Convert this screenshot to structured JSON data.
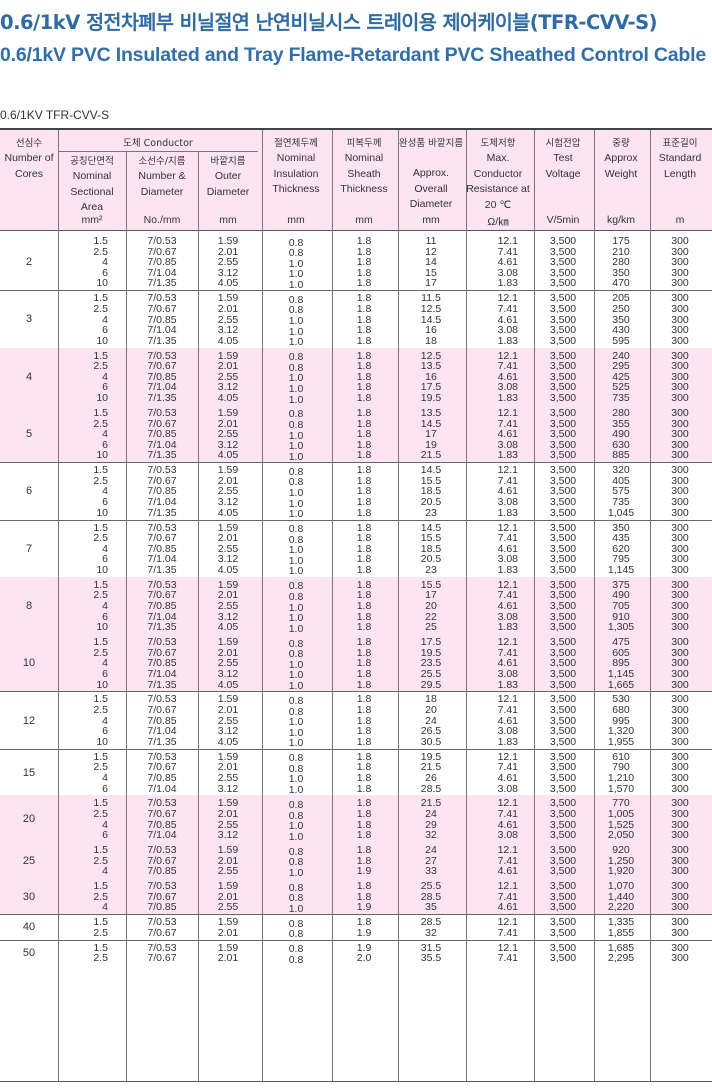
{
  "title_ko": "0.6/1kV  정전차폐부 비닐절연 난연비닐시스 트레이용 제어케이블(TFR-CVV-S)",
  "title_en": "0.6/1kV PVC Insulated and Tray Flame-Retardant PVC Sheathed Control Cable",
  "subtitle": "0.6/1KV TFR-CVV-S",
  "headers": {
    "cores_ko": "선심수",
    "cores_en": "Number of Cores",
    "conductor": "도체 Conductor",
    "area_ko": "공칭단면적",
    "area_en": "Nominal Sectional Area",
    "wire_ko": "소선수/지름",
    "wire_en": "Number & Diameter",
    "od_ko": "바깥지름",
    "od_en": "Outer Diameter",
    "ins_ko": "절연체두께",
    "ins_en": "Nominal Insulation Thickness",
    "sheath_ko": "피복두께",
    "sheath_en": "Nominal Sheath Thickness",
    "overall_ko": "완성품 바깥지름",
    "overall_en": "Approx. Overall Diameter",
    "res_ko": "도체저항",
    "res_en": "Max. Conductor Resistance at 20 ℃",
    "volt_ko": "시험전압",
    "volt_en": "Test Voltage",
    "weight_ko": "중량",
    "weight_en": "Approx Weight",
    "length_ko": "표준길이",
    "length_en": "Standard Length"
  },
  "units": {
    "area": "mm²",
    "wire": "No./mm",
    "od": "mm",
    "ins": "mm",
    "sheath": "mm",
    "overall": "mm",
    "res": "Ω/㎞",
    "volt": "V/5min",
    "weight": "kg/km",
    "length": "m"
  },
  "groups": [
    {
      "cores": "2",
      "pink": false,
      "rows": [
        [
          "1.5",
          "7/0.53",
          "1.59",
          "0.8",
          "1.8",
          "11",
          "12.1",
          "3,500",
          "175",
          "300"
        ],
        [
          "2.5",
          "7/0.67",
          "2.01",
          "0.8",
          "1.8",
          "12",
          "7.41",
          "3,500",
          "210",
          "300"
        ],
        [
          "4",
          "7/0.85",
          "2.55",
          "1.0",
          "1.8",
          "14",
          "4.61",
          "3,500",
          "280",
          "300"
        ],
        [
          "6",
          "7/1.04",
          "3.12",
          "1.0",
          "1.8",
          "15",
          "3.08",
          "3,500",
          "350",
          "300"
        ],
        [
          "10",
          "7/1.35",
          "4.05",
          "1.0",
          "1.8",
          "17",
          "1.83",
          "3,500",
          "470",
          "300"
        ]
      ]
    },
    {
      "cores": "3",
      "pink": false,
      "rows": [
        [
          "1.5",
          "7/0.53",
          "1.59",
          "0.8",
          "1.8",
          "11.5",
          "12.1",
          "3,500",
          "205",
          "300"
        ],
        [
          "2.5",
          "7/0.67",
          "2.01",
          "0.8",
          "1.8",
          "12.5",
          "7.41",
          "3,500",
          "250",
          "300"
        ],
        [
          "4",
          "7/0.85",
          "2.55",
          "1.0",
          "1.8",
          "14.5",
          "4.61",
          "3,500",
          "350",
          "300"
        ],
        [
          "6",
          "7/1.04",
          "3.12",
          "1.0",
          "1.8",
          "16",
          "3.08",
          "3,500",
          "430",
          "300"
        ],
        [
          "10",
          "7/1.35",
          "4.05",
          "1.0",
          "1.8",
          "18",
          "1.83",
          "3,500",
          "595",
          "300"
        ]
      ]
    },
    {
      "cores": "4",
      "pink": true,
      "rows": [
        [
          "1.5",
          "7/0.53",
          "1.59",
          "0.8",
          "1.8",
          "12.5",
          "12.1",
          "3,500",
          "240",
          "300"
        ],
        [
          "2.5",
          "7/0.67",
          "2.01",
          "0.8",
          "1.8",
          "13.5",
          "7.41",
          "3,500",
          "295",
          "300"
        ],
        [
          "4",
          "7/0.85",
          "2.55",
          "1.0",
          "1.8",
          "16",
          "4.61",
          "3,500",
          "425",
          "300"
        ],
        [
          "6",
          "7/1.04",
          "3.12",
          "1.0",
          "1.8",
          "17.5",
          "3.08",
          "3,500",
          "525",
          "300"
        ],
        [
          "10",
          "7/1.35",
          "4.05",
          "1.0",
          "1.8",
          "19.5",
          "1.83",
          "3,500",
          "735",
          "300"
        ]
      ]
    },
    {
      "cores": "5",
      "pink": true,
      "rows": [
        [
          "1.5",
          "7/0.53",
          "1.59",
          "0.8",
          "1.8",
          "13.5",
          "12.1",
          "3,500",
          "280",
          "300"
        ],
        [
          "2.5",
          "7/0.67",
          "2.01",
          "0.8",
          "1.8",
          "14.5",
          "7.41",
          "3,500",
          "355",
          "300"
        ],
        [
          "4",
          "7/0.85",
          "2.55",
          "1.0",
          "1.8",
          "17",
          "4.61",
          "3,500",
          "490",
          "300"
        ],
        [
          "6",
          "7/1.04",
          "3.12",
          "1.0",
          "1.8",
          "19",
          "3.08",
          "3,500",
          "630",
          "300"
        ],
        [
          "10",
          "7/1.35",
          "4.05",
          "1.0",
          "1.8",
          "21.5",
          "1.83",
          "3,500",
          "885",
          "300"
        ]
      ]
    },
    {
      "cores": "6",
      "pink": false,
      "rows": [
        [
          "1.5",
          "7/0.53",
          "1.59",
          "0.8",
          "1.8",
          "14.5",
          "12.1",
          "3,500",
          "320",
          "300"
        ],
        [
          "2.5",
          "7/0.67",
          "2.01",
          "0.8",
          "1.8",
          "15.5",
          "7.41",
          "3,500",
          "405",
          "300"
        ],
        [
          "4",
          "7/0.85",
          "2.55",
          "1.0",
          "1.8",
          "18.5",
          "4.61",
          "3,500",
          "575",
          "300"
        ],
        [
          "6",
          "7/1.04",
          "3.12",
          "1.0",
          "1.8",
          "20.5",
          "3.08",
          "3,500",
          "735",
          "300"
        ],
        [
          "10",
          "7/1.35",
          "4.05",
          "1.0",
          "1.8",
          "23",
          "1.83",
          "3,500",
          "1,045",
          "300"
        ]
      ]
    },
    {
      "cores": "7",
      "pink": false,
      "rows": [
        [
          "1.5",
          "7/0.53",
          "1.59",
          "0.8",
          "1.8",
          "14.5",
          "12.1",
          "3,500",
          "350",
          "300"
        ],
        [
          "2.5",
          "7/0.67",
          "2.01",
          "0.8",
          "1.8",
          "15.5",
          "7.41",
          "3,500",
          "435",
          "300"
        ],
        [
          "4",
          "7/0.85",
          "2.55",
          "1.0",
          "1.8",
          "18.5",
          "4.61",
          "3,500",
          "620",
          "300"
        ],
        [
          "6",
          "7/1.04",
          "3.12",
          "1.0",
          "1.8",
          "20.5",
          "3.08",
          "3,500",
          "795",
          "300"
        ],
        [
          "10",
          "7/1.35",
          "4.05",
          "1.0",
          "1.8",
          "23",
          "1.83",
          "3,500",
          "1,145",
          "300"
        ]
      ]
    },
    {
      "cores": "8",
      "pink": true,
      "rows": [
        [
          "1.5",
          "7/0.53",
          "1.59",
          "0.8",
          "1.8",
          "15.5",
          "12.1",
          "3,500",
          "375",
          "300"
        ],
        [
          "2.5",
          "7/0.67",
          "2.01",
          "0.8",
          "1.8",
          "17",
          "7.41",
          "3,500",
          "490",
          "300"
        ],
        [
          "4",
          "7/0.85",
          "2.55",
          "1.0",
          "1.8",
          "20",
          "4.61",
          "3,500",
          "705",
          "300"
        ],
        [
          "6",
          "7/1.04",
          "3.12",
          "1.0",
          "1.8",
          "22",
          "3.08",
          "3,500",
          "910",
          "300"
        ],
        [
          "10",
          "7/1.35",
          "4.05",
          "1.0",
          "1.8",
          "25",
          "1.83",
          "3,500",
          "1,305",
          "300"
        ]
      ]
    },
    {
      "cores": "10",
      "pink": true,
      "rows": [
        [
          "1.5",
          "7/0.53",
          "1.59",
          "0.8",
          "1.8",
          "17.5",
          "12.1",
          "3,500",
          "475",
          "300"
        ],
        [
          "2.5",
          "7/0.67",
          "2.01",
          "0.8",
          "1.8",
          "19.5",
          "7.41",
          "3,500",
          "605",
          "300"
        ],
        [
          "4",
          "7/0.85",
          "2.55",
          "1.0",
          "1.8",
          "23.5",
          "4.61",
          "3,500",
          "895",
          "300"
        ],
        [
          "6",
          "7/1.04",
          "3.12",
          "1.0",
          "1.8",
          "25.5",
          "3.08",
          "3,500",
          "1,145",
          "300"
        ],
        [
          "10",
          "7/1.35",
          "4.05",
          "1.0",
          "1.8",
          "29.5",
          "1.83",
          "3,500",
          "1,665",
          "300"
        ]
      ]
    },
    {
      "cores": "12",
      "pink": false,
      "rows": [
        [
          "1.5",
          "7/0.53",
          "1.59",
          "0.8",
          "1.8",
          "18",
          "12.1",
          "3,500",
          "530",
          "300"
        ],
        [
          "2.5",
          "7/0.67",
          "2.01",
          "0.8",
          "1.8",
          "20",
          "7.41",
          "3,500",
          "680",
          "300"
        ],
        [
          "4",
          "7/0.85",
          "2.55",
          "1.0",
          "1.8",
          "24",
          "4.61",
          "3,500",
          "995",
          "300"
        ],
        [
          "6",
          "7/1.04",
          "3.12",
          "1.0",
          "1.8",
          "26.5",
          "3.08",
          "3,500",
          "1,320",
          "300"
        ],
        [
          "10",
          "7/1.35",
          "4.05",
          "1.0",
          "1.8",
          "30.5",
          "1.83",
          "3,500",
          "1,955",
          "300"
        ]
      ]
    },
    {
      "cores": "15",
      "pink": false,
      "rows": [
        [
          "1.5",
          "7/0.53",
          "1.59",
          "0.8",
          "1.8",
          "19.5",
          "12.1",
          "3,500",
          "610",
          "300"
        ],
        [
          "2.5",
          "7/0.67",
          "2.01",
          "0.8",
          "1.8",
          "21.5",
          "7.41",
          "3,500",
          "790",
          "300"
        ],
        [
          "4",
          "7/0.85",
          "2.55",
          "1.0",
          "1.8",
          "26",
          "4.61",
          "3,500",
          "1,210",
          "300"
        ],
        [
          "6",
          "7/1.04",
          "3.12",
          "1.0",
          "1.8",
          "28.5",
          "3.08",
          "3,500",
          "1,570",
          "300"
        ]
      ]
    },
    {
      "cores": "20",
      "pink": true,
      "rows": [
        [
          "1.5",
          "7/0.53",
          "1.59",
          "0.8",
          "1.8",
          "21.5",
          "12.1",
          "3,500",
          "770",
          "300"
        ],
        [
          "2.5",
          "7/0.67",
          "2.01",
          "0.8",
          "1.8",
          "24",
          "7.41",
          "3,500",
          "1,005",
          "300"
        ],
        [
          "4",
          "7/0.85",
          "2.55",
          "1.0",
          "1.8",
          "29",
          "4.61",
          "3,500",
          "1,525",
          "300"
        ],
        [
          "6",
          "7/1.04",
          "3.12",
          "1.0",
          "1.8",
          "32",
          "3.08",
          "3,500",
          "2,050",
          "300"
        ]
      ]
    },
    {
      "cores": "25",
      "pink": true,
      "rows": [
        [
          "1.5",
          "7/0.53",
          "1.59",
          "0.8",
          "1.8",
          "24",
          "12.1",
          "3,500",
          "920",
          "300"
        ],
        [
          "2.5",
          "7/0.67",
          "2.01",
          "0.8",
          "1.8",
          "27",
          "7.41",
          "3,500",
          "1,250",
          "300"
        ],
        [
          "4",
          "7/0.85",
          "2.55",
          "1.0",
          "1.9",
          "33",
          "4.61",
          "3,500",
          "1,920",
          "300"
        ]
      ]
    },
    {
      "cores": "30",
      "pink": true,
      "rows": [
        [
          "1.5",
          "7/0.53",
          "1.59",
          "0.8",
          "1.8",
          "25.5",
          "12.1",
          "3,500",
          "1,070",
          "300"
        ],
        [
          "2.5",
          "7/0.67",
          "2.01",
          "0.8",
          "1.8",
          "28.5",
          "7.41",
          "3,500",
          "1,440",
          "300"
        ],
        [
          "4",
          "7/0.85",
          "2.55",
          "1.0",
          "1.9",
          "35",
          "4.61",
          "3,500",
          "2,220",
          "300"
        ]
      ]
    },
    {
      "cores": "40",
      "pink": false,
      "rows": [
        [
          "1.5",
          "7/0.53",
          "1.59",
          "0.8",
          "1.8",
          "28.5",
          "12.1",
          "3,500",
          "1,335",
          "300"
        ],
        [
          "2.5",
          "7/0.67",
          "2.01",
          "0.8",
          "1.9",
          "32",
          "7.41",
          "3,500",
          "1,855",
          "300"
        ]
      ]
    },
    {
      "cores": "50",
      "pink": false,
      "rows": [
        [
          "1.5",
          "7/0.53",
          "1.59",
          "0.8",
          "1.9",
          "31.5",
          "12.1",
          "3,500",
          "1,685",
          "300"
        ],
        [
          "2.5",
          "7/0.67",
          "2.01",
          "0.8",
          "2.0",
          "35.5",
          "7.41",
          "3,500",
          "2,295",
          "300"
        ]
      ]
    }
  ]
}
